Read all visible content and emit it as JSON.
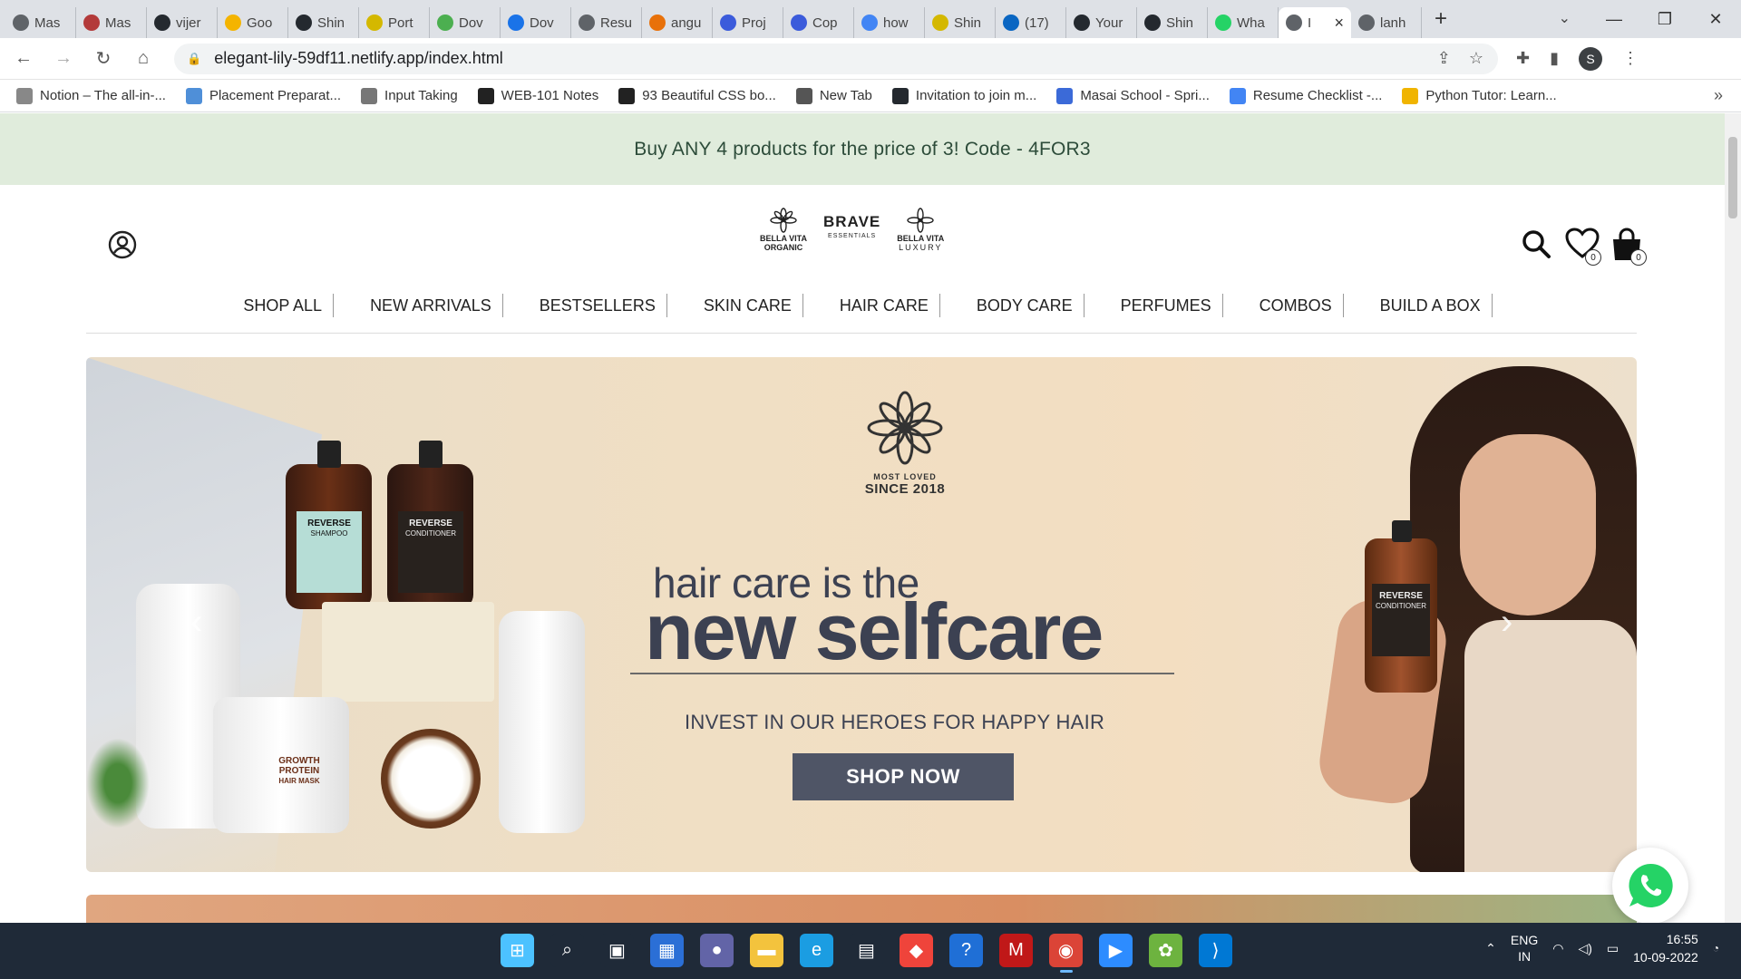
{
  "browser": {
    "tabs": [
      {
        "label": "Mas",
        "color": "#5f6368"
      },
      {
        "label": "Mas",
        "color": "#b33a3a"
      },
      {
        "label": "vijer",
        "color": "#24292f"
      },
      {
        "label": "Goo",
        "color": "#f4b400"
      },
      {
        "label": "Shin",
        "color": "#24292f"
      },
      {
        "label": "Port",
        "color": "#d4b800"
      },
      {
        "label": "Dov",
        "color": "#4caf50"
      },
      {
        "label": "Dov",
        "color": "#1a73e8"
      },
      {
        "label": "Resu",
        "color": "#5f6368"
      },
      {
        "label": "angu",
        "color": "#e8710a"
      },
      {
        "label": "Proj",
        "color": "#3b5bdb"
      },
      {
        "label": "Cop",
        "color": "#3b5bdb"
      },
      {
        "label": "how",
        "color": "#4285f4"
      },
      {
        "label": "Shin",
        "color": "#d4b800"
      },
      {
        "label": "(17)",
        "color": "#0a66c2"
      },
      {
        "label": "Your",
        "color": "#24292f"
      },
      {
        "label": "Shin",
        "color": "#24292f"
      },
      {
        "label": "Wha",
        "color": "#25d366"
      },
      {
        "label": "I",
        "color": "#5f6368",
        "active": true
      },
      {
        "label": "lanh",
        "color": "#5f6368"
      }
    ],
    "url": "elegant-lily-59df11.netlify.app/index.html",
    "profile_initial": "S",
    "bookmarks": [
      {
        "label": "Notion – The all-in-...",
        "color": "#888"
      },
      {
        "label": "Placement Preparat...",
        "color": "#4f8fd8"
      },
      {
        "label": "Input Taking",
        "color": "#777"
      },
      {
        "label": "WEB-101 Notes",
        "color": "#222"
      },
      {
        "label": "93 Beautiful CSS bo...",
        "color": "#222"
      },
      {
        "label": "New Tab",
        "color": "#555"
      },
      {
        "label": "Invitation to join m...",
        "color": "#24292f"
      },
      {
        "label": "Masai School - Spri...",
        "color": "#3b6ad8"
      },
      {
        "label": "Resume Checklist -...",
        "color": "#4285f4"
      },
      {
        "label": "Python Tutor: Learn...",
        "color": "#f0b400"
      }
    ]
  },
  "page": {
    "promo_text": "Buy ANY 4 products for the price of 3! Code - 4FOR3",
    "logos": {
      "bella_organic_1": "BELLA VITA",
      "bella_organic_2": "ORGANIC",
      "brave_1": "BRAVE",
      "brave_2": "ESSENTIALS",
      "luxury_1": "BELLA VITA",
      "luxury_2": "LUXURY"
    },
    "wishlist_count": "0",
    "cart_count": "0",
    "menu": [
      "SHOP ALL",
      "NEW ARRIVALS",
      "BESTSELLERS",
      "SKIN CARE",
      "HAIR CARE",
      "BODY CARE",
      "PERFUMES",
      "COMBOS",
      "BUILD A BOX"
    ],
    "hero": {
      "brand_top": "MOST LOVED",
      "brand_since": "SINCE 2018",
      "headline_small": "hair care is the",
      "headline_big": "new selfcare",
      "tagline": "INVEST IN OUR HEROES FOR HAPPY HAIR",
      "cta": "SHOP NOW",
      "label_reverse": "REVERSE",
      "label_shampoo": "SHAMPOO",
      "label_conditioner": "CONDITIONER",
      "label_growth": "GROWTH PROTEIN",
      "label_mask": "HAIR MASK"
    }
  },
  "taskbar": {
    "apps": [
      {
        "name": "windows-start",
        "color": "#4cc2ff",
        "glyph": "⊞"
      },
      {
        "name": "search",
        "color": "#1f2a38",
        "glyph": "⌕"
      },
      {
        "name": "task-view",
        "color": "#1f2a38",
        "glyph": "▣"
      },
      {
        "name": "widgets",
        "color": "#2b6fd6",
        "glyph": "▦"
      },
      {
        "name": "teams-chat",
        "color": "#6264a7",
        "glyph": "●"
      },
      {
        "name": "file-explorer",
        "color": "#f3c33d",
        "glyph": "▬"
      },
      {
        "name": "edge",
        "color": "#1b9de2",
        "glyph": "e"
      },
      {
        "name": "store",
        "color": "#1f2a38",
        "glyph": "▤"
      },
      {
        "name": "anydesk",
        "color": "#ef443b",
        "glyph": "◆"
      },
      {
        "name": "help",
        "color": "#1f6fd6",
        "glyph": "?"
      },
      {
        "name": "mcafee",
        "color": "#c01818",
        "glyph": "M"
      },
      {
        "name": "chrome",
        "color": "#db4437",
        "glyph": "◉",
        "active": true
      },
      {
        "name": "zoom",
        "color": "#2d8cff",
        "glyph": "▶"
      },
      {
        "name": "spring-tool",
        "color": "#6db33f",
        "glyph": "✿"
      },
      {
        "name": "vscode",
        "color": "#0078d4",
        "glyph": "⟩"
      }
    ],
    "lang_1": "ENG",
    "lang_2": "IN",
    "time": "16:55",
    "date": "10-09-2022"
  }
}
